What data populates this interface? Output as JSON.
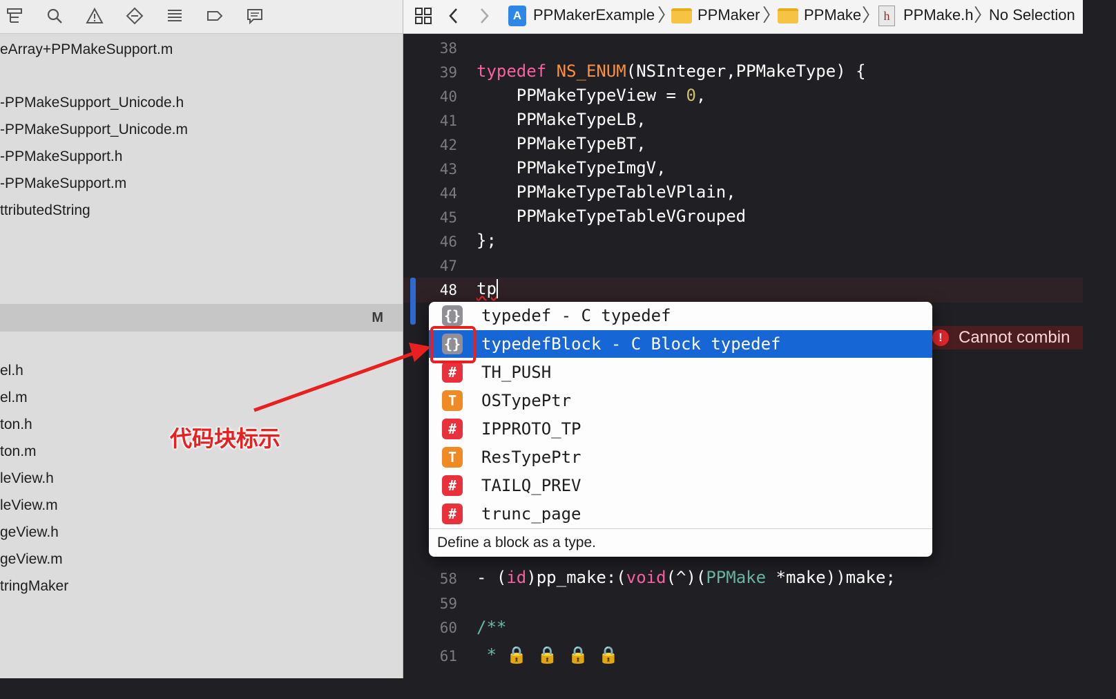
{
  "navigator": {
    "toolbar_icons": [
      "hierarchy-icon",
      "search-icon",
      "warning-icon",
      "diamond-icon",
      "list-icon",
      "tag-icon",
      "message-icon"
    ],
    "files_top": [
      "eArray+PPMakeSupport.m",
      "-PPMakeSupport_Unicode.h",
      "-PPMakeSupport_Unicode.m",
      "-PPMakeSupport.h",
      "-PPMakeSupport.m",
      "ttributedString"
    ],
    "group_badge": "M",
    "files_bottom": [
      "el.h",
      "el.m",
      "ton.h",
      "ton.m",
      "leView.h",
      "leView.m",
      "geView.h",
      "geView.m",
      "tringMaker"
    ]
  },
  "jumpbar": {
    "crumbs": [
      "PPMakerExample",
      "PPMaker",
      "PPMake",
      "PPMake.h",
      "No Selection"
    ],
    "h_icon_letter": "h"
  },
  "editor": {
    "lines": [
      {
        "n": "38"
      },
      {
        "n": "39"
      },
      {
        "n": "40"
      },
      {
        "n": "41"
      },
      {
        "n": "42"
      },
      {
        "n": "43"
      },
      {
        "n": "44"
      },
      {
        "n": "45"
      },
      {
        "n": "46"
      },
      {
        "n": "47"
      },
      {
        "n": "48"
      },
      {
        "n": "58"
      },
      {
        "n": "59"
      },
      {
        "n": "60"
      },
      {
        "n": "61"
      }
    ],
    "code": {
      "l39_kw": "typedef",
      "l39_mac": "NS_ENUM",
      "l39_rest": "(NSInteger,PPMakeType) {",
      "l40_a": "    PPMakeTypeView = ",
      "l40_num": "0",
      "l40_b": ",",
      "l41": "    PPMakeTypeLB,",
      "l42": "    PPMakeTypeBT,",
      "l43": "    PPMakeTypeImgV,",
      "l44": "    PPMakeTypeTableVPlain,",
      "l45": "    PPMakeTypeTableVGrouped",
      "l46": "};",
      "l48": "tp",
      "l58_a": "- (",
      "l58_id": "id",
      "l58_b": ")pp_make:(",
      "l58_void": "void",
      "l58_c": "(^)(",
      "l58_cls": "PPMake",
      "l58_d": " *make))make;",
      "l60": "/**",
      "l61": " * 🔒 🔒 🔒 🔒"
    },
    "error_text": "Cannot combin"
  },
  "completion": {
    "items": [
      {
        "icon": "{}",
        "kind": "snip",
        "text": "typedef - C typedef"
      },
      {
        "icon": "{}",
        "kind": "snip",
        "text": "typedefBlock - C Block typedef",
        "selected": true
      },
      {
        "icon": "#",
        "kind": "mac",
        "text": "TH_PUSH"
      },
      {
        "icon": "T",
        "kind": "typ",
        "text": "OSTypePtr"
      },
      {
        "icon": "#",
        "kind": "mac",
        "text": "IPPROTO_TP"
      },
      {
        "icon": "T",
        "kind": "typ",
        "text": "ResTypePtr"
      },
      {
        "icon": "#",
        "kind": "mac",
        "text": "TAILQ_PREV"
      },
      {
        "icon": "#",
        "kind": "mac",
        "text": "trunc_page"
      }
    ],
    "description": "Define a block as a type."
  },
  "annotation": {
    "label": "代码块标示",
    "color": "#e8201f"
  }
}
